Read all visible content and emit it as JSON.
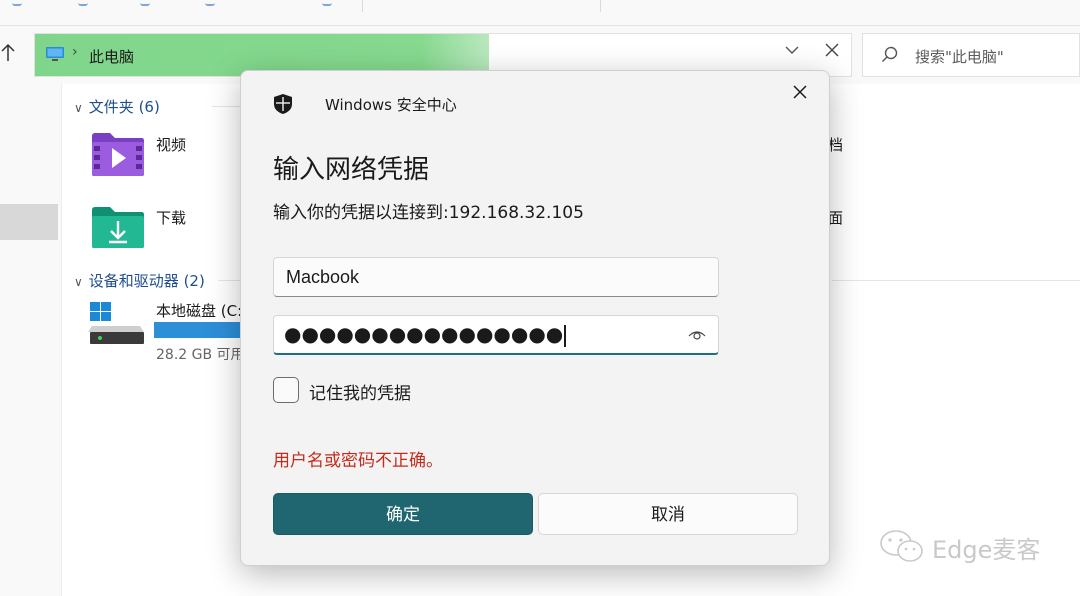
{
  "address": {
    "location": "此电脑",
    "search_placeholder": "搜索\"此电脑\""
  },
  "sections": {
    "folders": "文件夹 (6)",
    "devices": "设备和驱动器 (2)"
  },
  "items": {
    "videos": "视频",
    "downloads": "下载",
    "documents_partial": "档",
    "desktop_partial": "面",
    "local_disk": "本地磁盘 (C:",
    "local_disk_free": "28.2 GB 可用"
  },
  "dialog": {
    "app_name": "Windows 安全中心",
    "title": "输入网络凭据",
    "subtitle": "输入你的凭据以连接到:192.168.32.105",
    "username_value": "Macbook",
    "password_masked": "●●●●●●●●●●●●●●●●",
    "remember_label": "记住我的凭据",
    "error_message": "用户名或密码不正确。",
    "ok_label": "确定",
    "cancel_label": "取消"
  },
  "watermark": "Edge麦客",
  "colors": {
    "address_highlight": "#7fd68a",
    "ok_button": "#1f6670",
    "error_text": "#c42b1c",
    "section_header": "#1f4e8c",
    "drive_bar": "#2c8fd8"
  }
}
